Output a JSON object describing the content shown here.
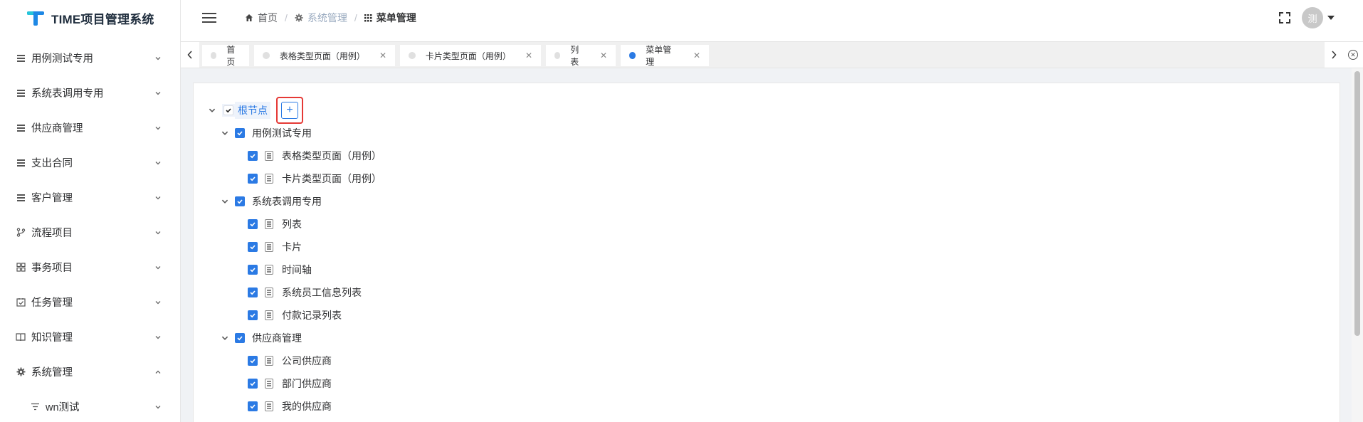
{
  "app": {
    "title": "TIME项目管理系统"
  },
  "sidebar": {
    "items": [
      {
        "label": "用例测试专用",
        "icon": "lines-icon",
        "expanded": false
      },
      {
        "label": "系统表调用专用",
        "icon": "lines-icon",
        "expanded": false
      },
      {
        "label": "供应商管理",
        "icon": "lines-icon",
        "expanded": false
      },
      {
        "label": "支出合同",
        "icon": "lines-icon",
        "expanded": false
      },
      {
        "label": "客户管理",
        "icon": "lines-icon",
        "expanded": false
      },
      {
        "label": "流程项目",
        "icon": "branch-icon",
        "expanded": false
      },
      {
        "label": "事务项目",
        "icon": "grid-icon",
        "expanded": false
      },
      {
        "label": "任务管理",
        "icon": "calendar-check-icon",
        "expanded": false
      },
      {
        "label": "知识管理",
        "icon": "book-icon",
        "expanded": false
      },
      {
        "label": "系统管理",
        "icon": "gear-icon",
        "expanded": true
      },
      {
        "label": "wn测试",
        "icon": "filter-icon",
        "expanded": false
      }
    ]
  },
  "header": {
    "breadcrumb": [
      {
        "label": "首页",
        "icon": "home-icon"
      },
      {
        "label": "系统管理",
        "icon": "gear-icon"
      },
      {
        "label": "菜单管理",
        "icon": "grid-dots-icon"
      }
    ],
    "avatar_text": "测"
  },
  "tabs": [
    {
      "label": "首页",
      "closable": false,
      "active": false
    },
    {
      "label": "表格类型页面（用例）",
      "closable": true,
      "active": false
    },
    {
      "label": "卡片类型页面（用例）",
      "closable": true,
      "active": false
    },
    {
      "label": "列表",
      "closable": true,
      "active": false
    },
    {
      "label": "菜单管理",
      "closable": true,
      "active": true
    }
  ],
  "tree": {
    "root": {
      "label": "根节点",
      "add_label": "+"
    },
    "groups": [
      {
        "label": "用例测试专用",
        "children": [
          "表格类型页面（用例）",
          "卡片类型页面（用例）"
        ]
      },
      {
        "label": "系统表调用专用",
        "children": [
          "列表",
          "卡片",
          "时间轴",
          "系统员工信息列表",
          "付款记录列表"
        ]
      },
      {
        "label": "供应商管理",
        "children": [
          "公司供应商",
          "部门供应商",
          "我的供应商"
        ]
      }
    ]
  },
  "colors": {
    "accent": "#2b7ae4",
    "highlight_border": "#e53935"
  }
}
